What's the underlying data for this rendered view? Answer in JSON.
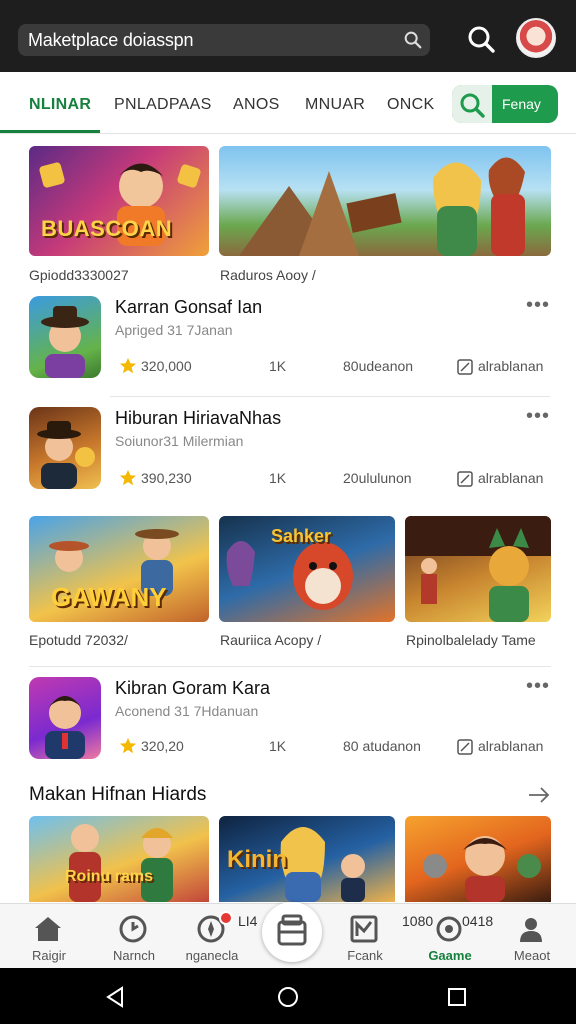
{
  "search": {
    "text": "Maketplace doiasspn"
  },
  "tabs": [
    {
      "label": "NLINAR"
    },
    {
      "label": "PNLADPAAS"
    },
    {
      "label": "ANOS"
    },
    {
      "label": "MNUAR"
    },
    {
      "label": "ONCK"
    }
  ],
  "filter": {
    "label": "Fenay"
  },
  "banners": [
    {
      "word": "BUASCOAN",
      "caption": "Gpiodd3330027"
    },
    {
      "caption": "Raduros Aooy /"
    }
  ],
  "items": [
    {
      "title": "Karran Gonsaf Ian",
      "subtitle": "Apriged 31 7Janan",
      "rating": "320,000",
      "count": "1K",
      "downloads": "80udeanon",
      "link": "alrablanan"
    },
    {
      "title": "Hiburan HiriavaNhas",
      "subtitle": "Soiunor31 Milermian",
      "rating": "390,230",
      "count": "1K",
      "downloads": "20ululunon",
      "link": "alrablanan"
    },
    {
      "title": "Kibran Goram Kara",
      "subtitle": "Aconend 31 7Hdanuan",
      "rating": "320,20",
      "count": "1K",
      "downloads": "80 atudanon",
      "link": "alrablanan"
    }
  ],
  "promos": [
    {
      "word": "GAWANY",
      "caption": "Epotudd 72032/"
    },
    {
      "word": "Sahker",
      "caption": "Rauriica Acopy /"
    },
    {
      "caption": "Rpinolbalelady Tame"
    }
  ],
  "section": {
    "title": "Makan Hifnan Hiards"
  },
  "covers": [
    {
      "word": "Roinu rams"
    },
    {
      "word": "Kinin"
    },
    {
      "word": ""
    }
  ],
  "nav": [
    {
      "label": "Raigir"
    },
    {
      "label": "Narnch"
    },
    {
      "label": "nganecla"
    },
    {
      "label": ""
    },
    {
      "label": "Fcank"
    },
    {
      "label": "Gaame"
    },
    {
      "label": "Meaot"
    }
  ],
  "nav_extra": {
    "text_a": "LI4",
    "text_b": "1080",
    "text_c": "0418"
  },
  "colors": {
    "accent": "#17803d",
    "topbar": "#1e1e1e"
  }
}
